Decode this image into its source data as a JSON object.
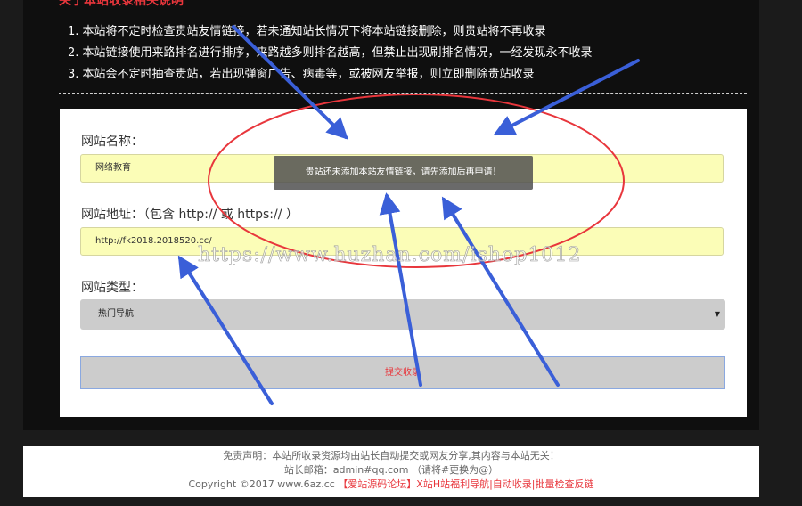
{
  "notice": {
    "heading": "关于本站收录相关说明",
    "items": [
      "1. 本站将不定时检查贵站友情链接，若未通知站长情况下将本站链接删除，则贵站将不再收录",
      "2. 本站链接使用来路排名进行排序，来路越多则排名越高，但禁止出现刷排名情况，一经发现永不收录",
      "3. 本站会不定时抽查贵站，若出现弹窗广告、病毒等，或被网友举报，则立即删除贵站收录"
    ]
  },
  "form": {
    "site_name_label": "网站名称：",
    "site_name_value": "网络教育",
    "site_url_label": "网站地址：（包含 http:// 或 https:// ）",
    "site_url_value": "http://fk2018.2018520.cc/",
    "site_type_label": "网站类型：",
    "site_type_selected": "热门导航",
    "submit_label": "提交收录"
  },
  "toast": "贵站还未添加本站友情链接，请先添加后再申请！",
  "watermark": "https://www.huzhan.com/ishop1012",
  "footer": {
    "disclaimer": "免责声明：本站所收录资源均由站长自动提交或网友分享,其内容与本站无关！",
    "email": "站长邮箱：admin#qq.com （请将#更换为@）",
    "copyright": "Copyright ©2017 www.6az.cc",
    "links": "【爱站源码论坛】X站H站福利导航|自动收录|批量检查反链"
  },
  "colors": {
    "accent_red": "#e8363c",
    "input_yellow": "#fbfdb7",
    "annotation_blue": "#3a5fd8"
  }
}
